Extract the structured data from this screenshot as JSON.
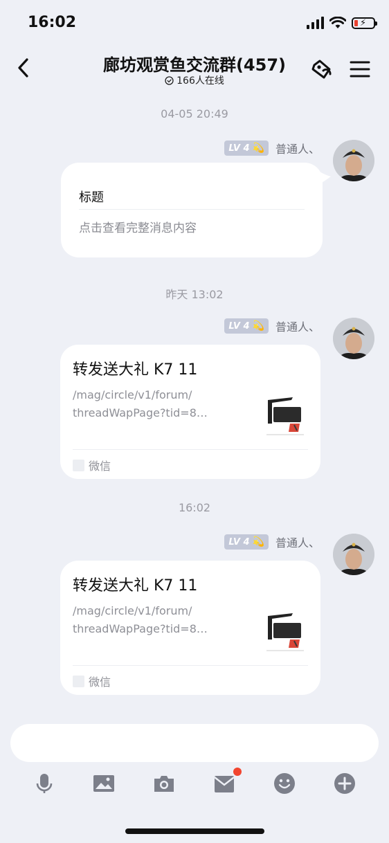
{
  "status": {
    "time": "16:02"
  },
  "header": {
    "title": "廊坊观赏鱼交流群(457)",
    "online": "166人在线"
  },
  "sender": {
    "level": "LV 4",
    "name": "普通人、"
  },
  "messages": [
    {
      "timestamp": "04-05 20:49",
      "type": "card",
      "title": "标题",
      "subtitle": "点击查看完整消息内容"
    },
    {
      "timestamp": "昨天 13:02",
      "type": "link",
      "title": "转发送大礼 K7 11",
      "url_line1": "/mag/circle/v1/forum/",
      "url_line2": "threadWapPage?tid=8…",
      "source": "微信"
    },
    {
      "timestamp": "16:02",
      "type": "link",
      "title": "转发送大礼 K7 11",
      "url_line1": "/mag/circle/v1/forum/",
      "url_line2": "threadWapPage?tid=8…",
      "source": "微信"
    }
  ],
  "toolbar": {
    "items": [
      "microphone-icon",
      "image-icon",
      "camera-icon",
      "red-packet-icon",
      "emoji-icon",
      "plus-icon"
    ]
  },
  "colors": {
    "background": "#eef0f6",
    "bubble": "#ffffff",
    "badge": "#c3c8d8",
    "dot": "#f2452f"
  }
}
